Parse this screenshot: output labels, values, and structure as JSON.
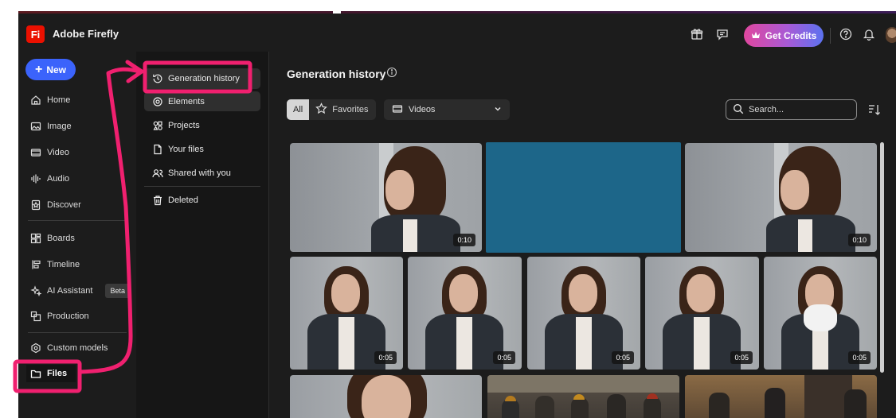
{
  "app": {
    "logo_text": "Fi",
    "title": "Adobe Firefly"
  },
  "header": {
    "icons": [
      "gift-icon",
      "feedback-icon",
      "help-icon",
      "bell-icon"
    ],
    "get_credits_label": "Get Credits",
    "credits_icon": "crown-icon"
  },
  "rail": {
    "new_label": "New",
    "items": [
      {
        "label": "Home",
        "icon": "home-icon"
      },
      {
        "label": "Image",
        "icon": "image-icon"
      },
      {
        "label": "Video",
        "icon": "video-icon"
      },
      {
        "label": "Audio",
        "icon": "audio-icon"
      },
      {
        "label": "Discover",
        "icon": "discover-icon"
      },
      {
        "label": "Boards",
        "icon": "boards-icon"
      },
      {
        "label": "Timeline",
        "icon": "timeline-icon"
      },
      {
        "label": "AI Assistant",
        "icon": "sparkle-icon",
        "badge": "Beta"
      },
      {
        "label": "Production",
        "icon": "production-icon"
      },
      {
        "label": "Custom models",
        "icon": "custom-models-icon"
      },
      {
        "label": "Files",
        "icon": "folder-icon"
      }
    ]
  },
  "panel": {
    "items": [
      {
        "label": "Generation history",
        "icon": "history-icon"
      },
      {
        "label": "Elements",
        "icon": "elements-icon"
      },
      {
        "label": "Projects",
        "icon": "projects-icon"
      },
      {
        "label": "Your files",
        "icon": "file-icon"
      },
      {
        "label": "Shared with you",
        "icon": "shared-icon"
      },
      {
        "label": "Deleted",
        "icon": "trash-icon"
      }
    ]
  },
  "main": {
    "title": "Generation history",
    "filter_all": "All",
    "filter_favorites": "Favorites",
    "type_dropdown": "Videos",
    "search_placeholder": "Search...",
    "tiles": [
      {
        "duration": "0:10"
      },
      {
        "duration": ""
      },
      {
        "duration": "0:10"
      },
      {
        "duration": "0:05"
      },
      {
        "duration": "0:05"
      },
      {
        "duration": "0:05"
      },
      {
        "duration": "0:05"
      },
      {
        "duration": "0:05"
      }
    ]
  },
  "colors": {
    "accent_blue": "#3b63fb",
    "annotation_pink": "#f0206f",
    "placeholder_tile": "#1d6689",
    "background": "#1c1c1c"
  }
}
